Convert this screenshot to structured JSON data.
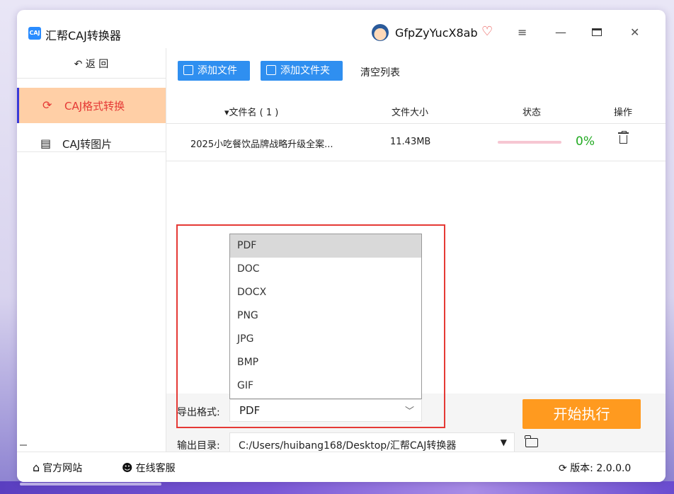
{
  "window": {
    "app_logo_text": "CAJ",
    "title": "汇帮CAJ转换器",
    "username": "GfpZyYucX8ab",
    "icons": [
      "vip-heart-icon",
      "menu-icon",
      "minimize-icon",
      "maximize-icon",
      "close-icon"
    ]
  },
  "sidebar": {
    "back_label": "↶ 返  回",
    "items": [
      {
        "icon": "refresh-icon",
        "glyph": "⟳",
        "label": "CAJ格式转换",
        "active": true
      },
      {
        "icon": "document-icon",
        "glyph": "▤",
        "label": "CAJ转图片",
        "active": false
      }
    ]
  },
  "toolbar": {
    "add_file_label": "添加文件",
    "add_folder_label": "添加文件夹",
    "clear_label": "清空列表"
  },
  "table": {
    "headers": {
      "name": "▾文件名 ( 1 )",
      "size": "文件大小",
      "status": "状态",
      "ops": "操作"
    },
    "rows": [
      {
        "name": "2025小吃餐饮品牌战略升级全案...",
        "size": "11.43MB",
        "progress": 0.0,
        "percent": "0%"
      }
    ]
  },
  "format": {
    "label": "导出格式:",
    "selected": "PDF",
    "options": [
      "PDF",
      "DOC",
      "DOCX",
      "PNG",
      "JPG",
      "BMP",
      "GIF"
    ]
  },
  "output": {
    "label": "输出目录:",
    "path": "C:/Users/huibang168/Desktop/汇帮CAJ转换器"
  },
  "start_button": "开始执行",
  "statusbar": {
    "website": "官方网站",
    "support": "在线客服",
    "version": "版本: 2.0.0.0"
  },
  "colors": {
    "accent_blue": "#2f8ff0",
    "start_orange": "#ff9a1f",
    "active_bg": "#ffcfa6",
    "active_text": "#e53935",
    "highlight_red": "#e53935",
    "progress_green": "#22aa22"
  }
}
